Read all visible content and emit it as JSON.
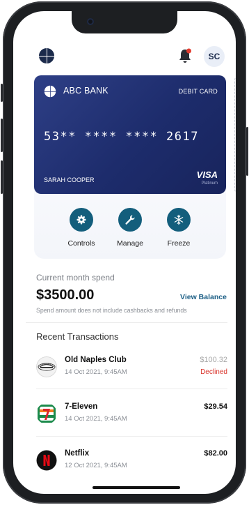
{
  "header": {
    "avatar_initials": "SC"
  },
  "card": {
    "bank_name": "ABC BANK",
    "card_type": "DEBIT CARD",
    "card_number": "53** **** **** 2617",
    "holder_name": "SARAH COOPER",
    "network": "VISA",
    "tier": "Platinum"
  },
  "actions": [
    {
      "label": "Controls",
      "icon": "gear-icon"
    },
    {
      "label": "Manage",
      "icon": "wrench-icon"
    },
    {
      "label": "Freeze",
      "icon": "snowflake-icon"
    }
  ],
  "spend": {
    "label": "Current month spend",
    "amount": "$3500.00",
    "view_balance": "View Balance",
    "note": "Spend amount does not include cashbacks and refunds"
  },
  "recent_title": "Recent Transactions",
  "transactions": [
    {
      "name": "Old Naples Club",
      "date": "14 Oct 2021, 9:45AM",
      "amount": "$100.32",
      "status": "Declined",
      "icon": "old-naples-club-logo"
    },
    {
      "name": "7-Eleven",
      "date": "14 Oct 2021, 9:45AM",
      "amount": "$29.54",
      "status": "",
      "icon": "seven-eleven-logo"
    },
    {
      "name": "Netflix",
      "date": "12 Oct 2021, 9:45AM",
      "amount": "$82.00",
      "status": "",
      "icon": "netflix-logo"
    }
  ],
  "colors": {
    "primary": "#135e7c",
    "card_gradient_start": "#2e3f86",
    "card_gradient_end": "#18245c",
    "declined": "#d9342b",
    "link": "#1b5e85"
  }
}
